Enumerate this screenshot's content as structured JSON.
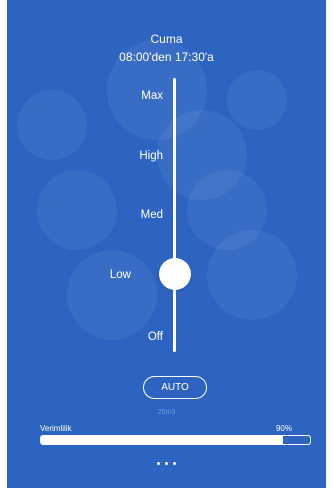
{
  "header": {
    "day": "Cuma",
    "time_range": "08:00'den 17:30'a"
  },
  "slider": {
    "levels": [
      "Max",
      "High",
      "Med",
      "Low",
      "Off"
    ],
    "selected": "Low"
  },
  "auto_button": {
    "label": "AUTO"
  },
  "sub_value": "25m3",
  "efficiency": {
    "label": "Verimlilik",
    "value": "90%",
    "fraction": 0.9
  },
  "colors": {
    "background": "#2d64c2",
    "foreground": "#ffffff",
    "muted_text": "#6f9be3"
  }
}
